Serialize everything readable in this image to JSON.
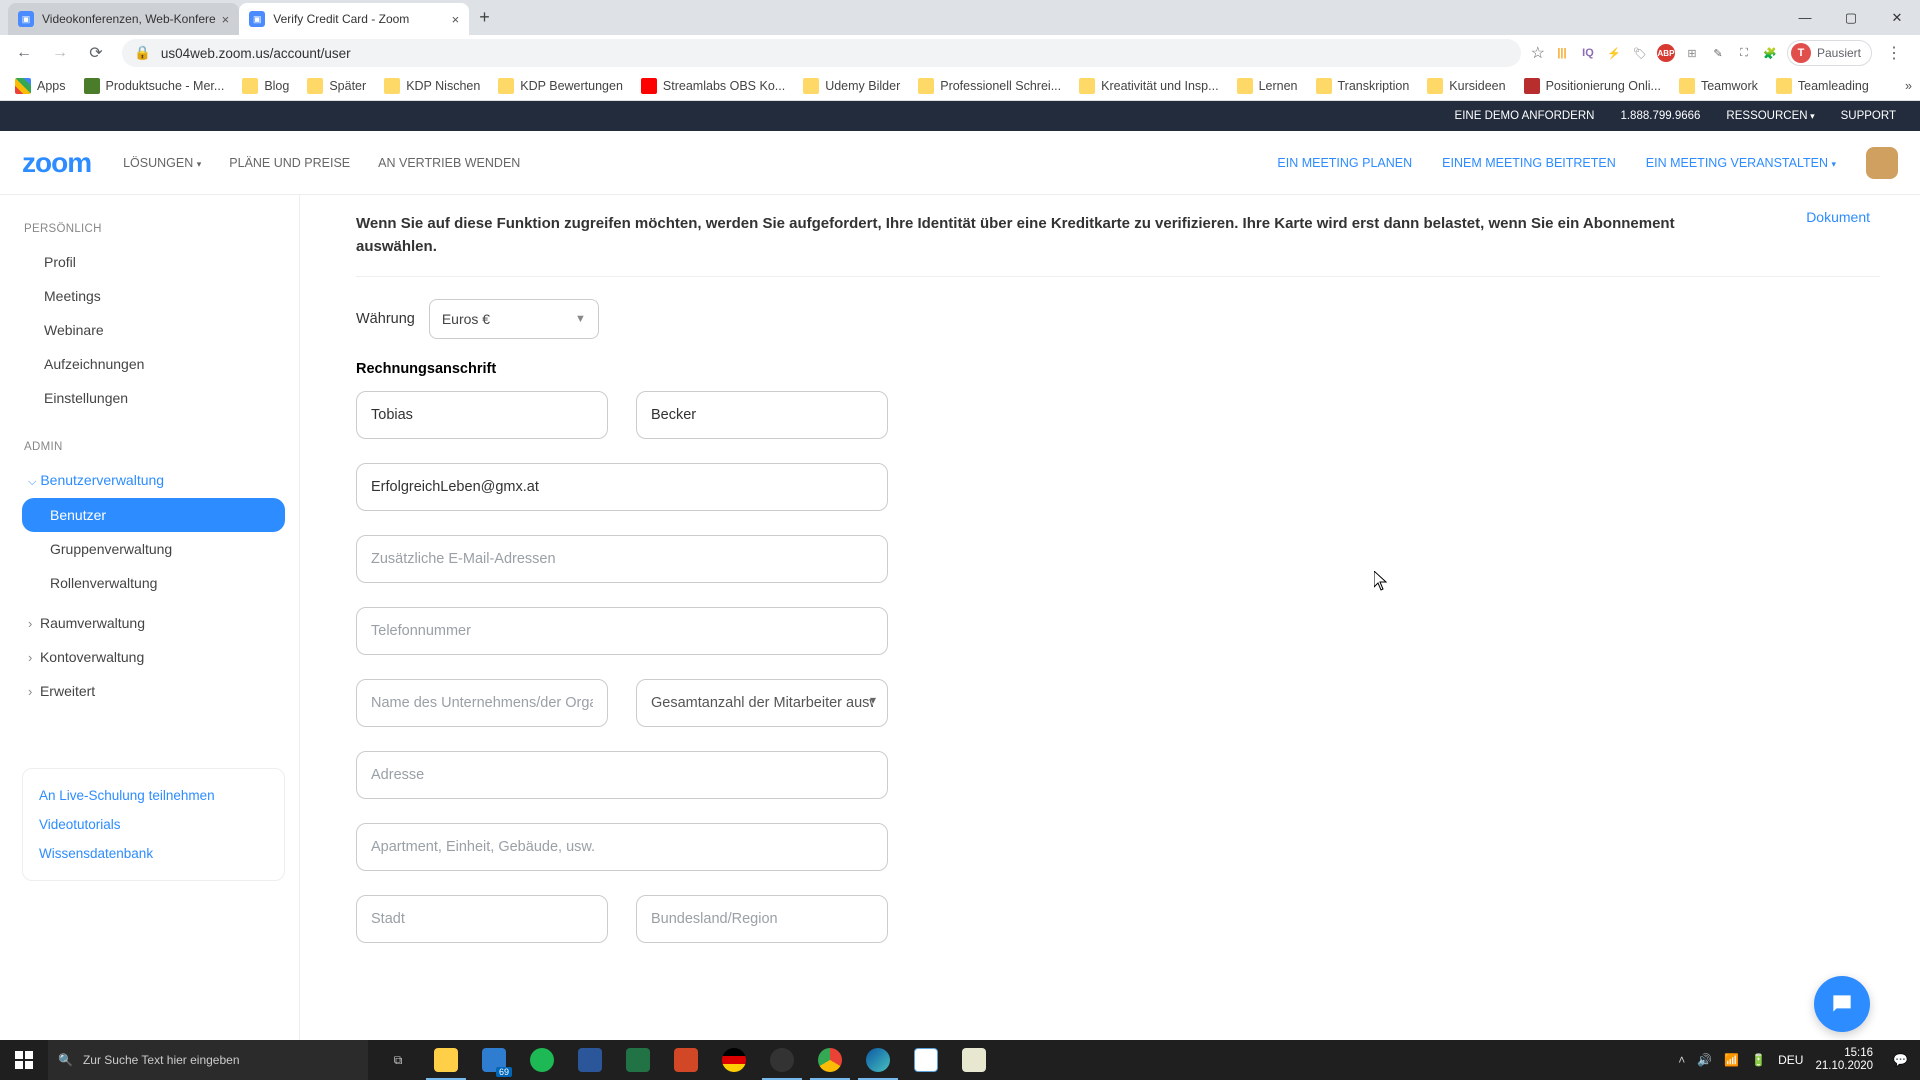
{
  "browser": {
    "tabs": [
      {
        "title": "Videokonferenzen, Web-Konfere"
      },
      {
        "title": "Verify Credit Card - Zoom"
      }
    ],
    "url": "us04web.zoom.us/account/user",
    "profile_label": "Pausiert",
    "profile_initial": "T",
    "bookmarks": [
      {
        "label": "Apps",
        "icon": "apps"
      },
      {
        "label": "Produktsuche - Mer...",
        "icon": "green"
      },
      {
        "label": "Blog",
        "icon": "fold"
      },
      {
        "label": "Später",
        "icon": "fold"
      },
      {
        "label": "KDP Nischen",
        "icon": "fold"
      },
      {
        "label": "KDP Bewertungen",
        "icon": "fold"
      },
      {
        "label": "Streamlabs OBS Ko...",
        "icon": "yt"
      },
      {
        "label": "Udemy Bilder",
        "icon": "fold"
      },
      {
        "label": "Professionell Schrei...",
        "icon": "fold"
      },
      {
        "label": "Kreativität und Insp...",
        "icon": "fold"
      },
      {
        "label": "Lernen",
        "icon": "fold"
      },
      {
        "label": "Transkription",
        "icon": "fold"
      },
      {
        "label": "Kursideen",
        "icon": "fold"
      },
      {
        "label": "Positionierung Onli...",
        "icon": "red"
      },
      {
        "label": "Teamwork",
        "icon": "fold"
      },
      {
        "label": "Teamleading",
        "icon": "fold"
      }
    ]
  },
  "zoom_top": {
    "demo": "EINE DEMO ANFORDERN",
    "phone": "1.888.799.9666",
    "resources": "RESSOURCEN",
    "support": "SUPPORT"
  },
  "zoom_nav": {
    "logo": "zoom",
    "left": [
      "LÖSUNGEN",
      "PLÄNE UND PREISE",
      "AN VERTRIEB WENDEN"
    ],
    "right": [
      "EIN MEETING PLANEN",
      "EINEM MEETING BEITRETEN",
      "EIN MEETING VERANSTALTEN"
    ]
  },
  "sidebar": {
    "sect1": "PERSÖNLICH",
    "items1": [
      "Profil",
      "Meetings",
      "Webinare",
      "Aufzeichnungen",
      "Einstellungen"
    ],
    "sect2": "ADMIN",
    "user_mgmt": "Benutzerverwaltung",
    "user_sub": [
      "Benutzer",
      "Gruppenverwaltung",
      "Rollenverwaltung"
    ],
    "collapse": [
      "Raumverwaltung",
      "Kontoverwaltung",
      "Erweitert"
    ],
    "foot": [
      "An Live-Schulung teilnehmen",
      "Videotutorials",
      "Wissensdatenbank"
    ]
  },
  "content": {
    "document": "Dokument",
    "intro": "Wenn Sie auf diese Funktion zugreifen möchten, werden Sie aufgefordert, Ihre Identität über eine Kreditkarte zu verifizieren. Ihre Karte wird erst dann belastet, wenn Sie ein Abonnement auswählen.",
    "currency_label": "Währung",
    "currency_value": "Euros €",
    "billing_header": "Rechnungsanschrift",
    "first_name": "Tobias",
    "last_name": "Becker",
    "email": "ErfolgreichLeben@gmx.at",
    "extra_email_ph": "Zusätzliche E-Mail-Adressen",
    "phone_ph": "Telefonnummer",
    "company_ph": "Name des Unternehmens/der Organisation",
    "employees_ph": "Gesamtanzahl der Mitarbeiter auswählen",
    "address_ph": "Adresse",
    "apt_ph": "Apartment, Einheit, Gebäude, usw.",
    "city_ph": "Stadt",
    "region_ph": "Bundesland/Region"
  },
  "taskbar": {
    "search_ph": "Zur Suche Text hier eingeben",
    "mail_badge": "69",
    "lang": "DEU",
    "time": "15:16",
    "date": "21.10.2020"
  }
}
